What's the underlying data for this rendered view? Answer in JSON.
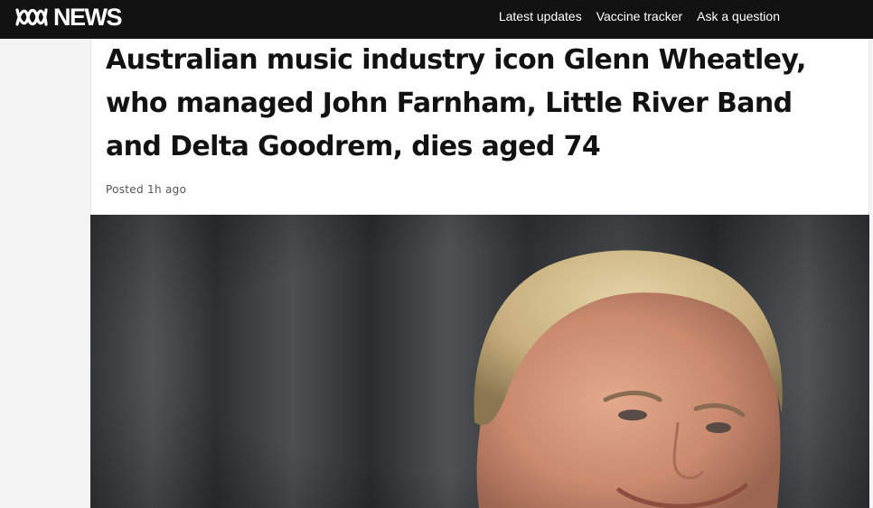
{
  "header": {
    "logo_text": "NEWS",
    "logo_icon": "abc-lissajous-icon",
    "nav": [
      {
        "label": "Latest updates"
      },
      {
        "label": "Vaccine tracker"
      },
      {
        "label": "Ask a question"
      }
    ]
  },
  "article": {
    "headline": "Australian music industry icon Glenn Wheatley, who managed John Farnham, Little River Band and Delta Goodrem, dies aged 74",
    "posted_label": "Posted",
    "posted_time": "1h ago"
  },
  "colors": {
    "header_bg": "#121212",
    "text": "#121212",
    "meta": "#555555"
  }
}
